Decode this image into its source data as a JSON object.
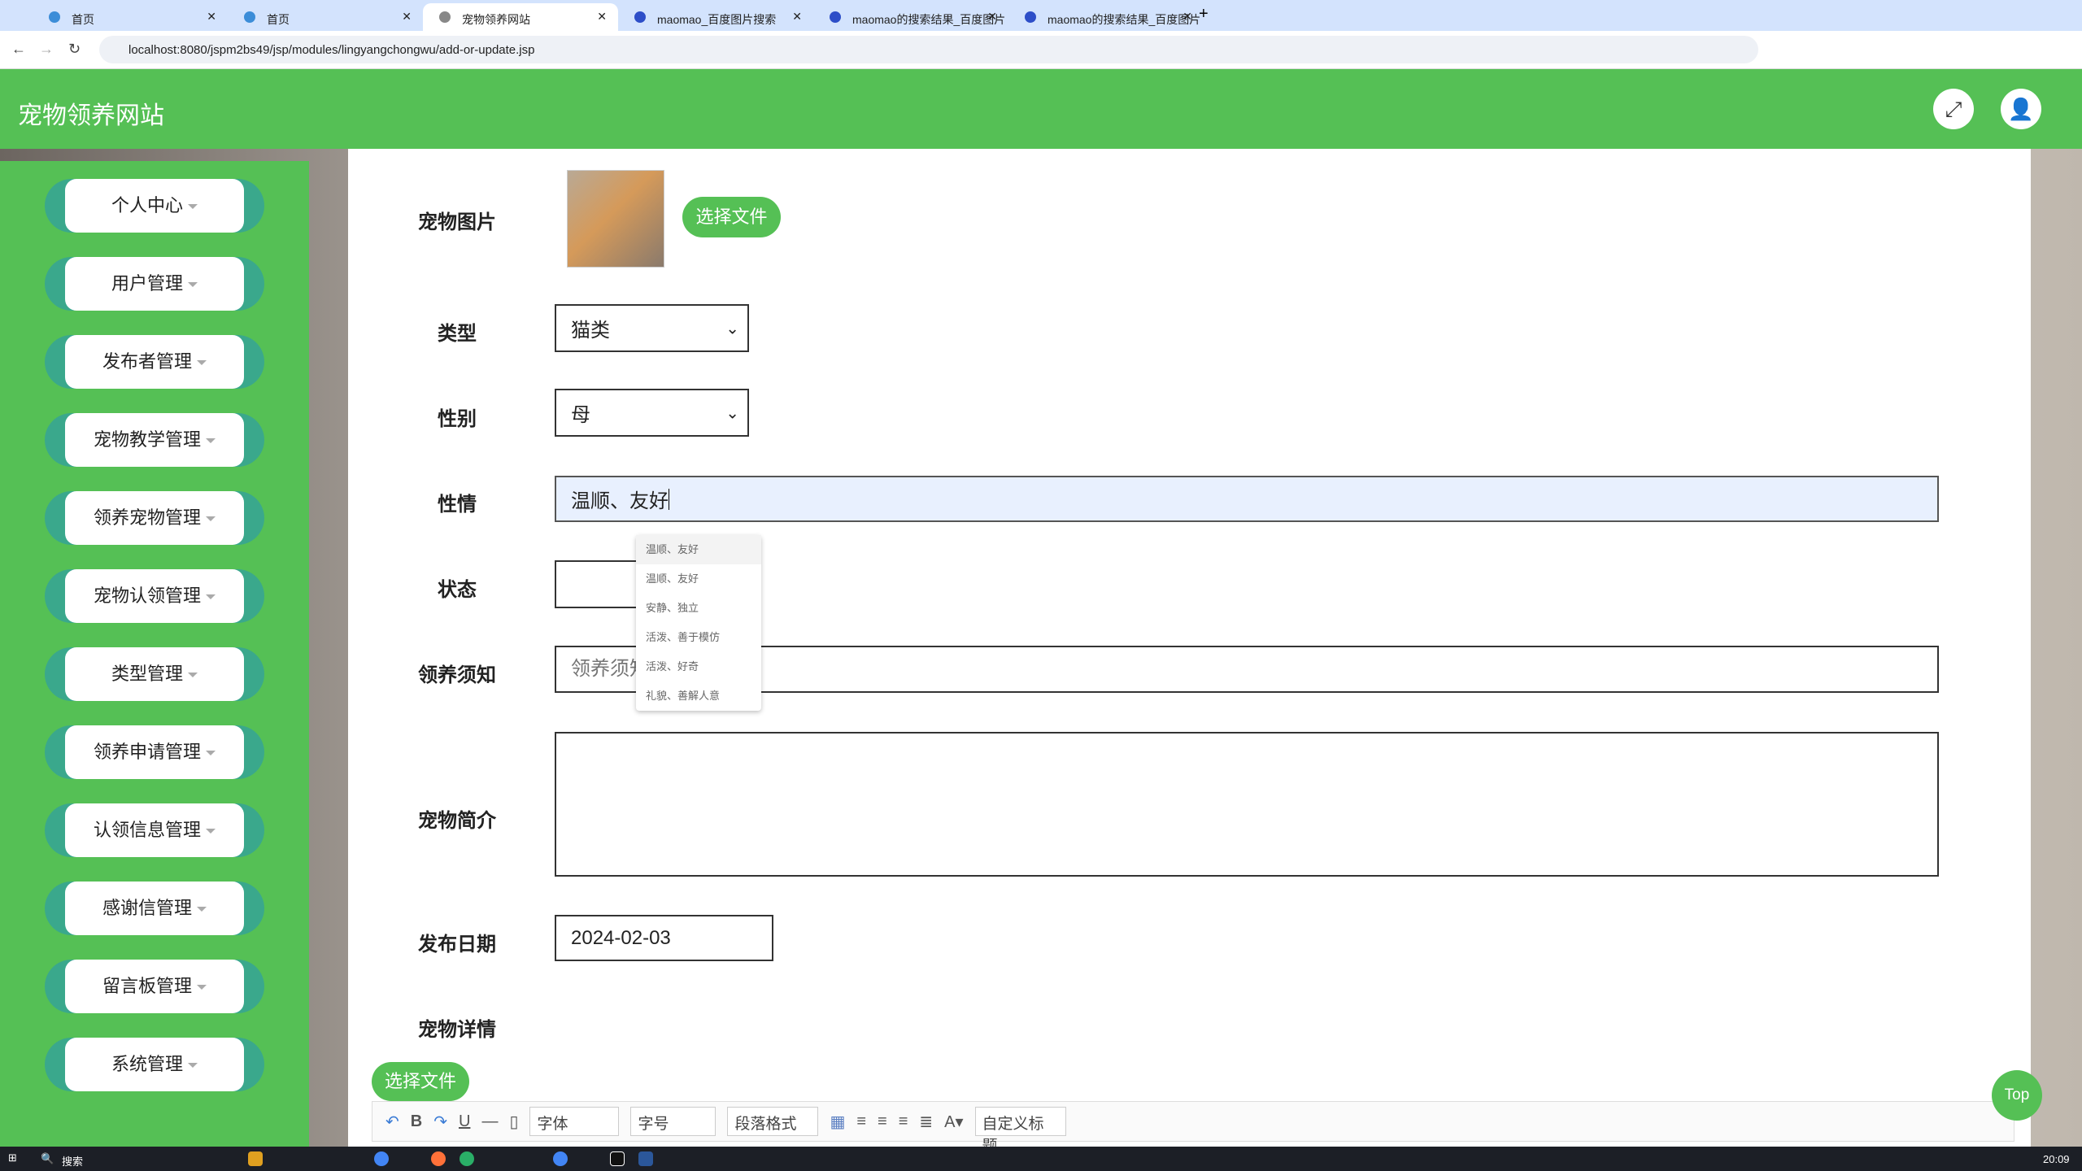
{
  "browser": {
    "tabs": [
      {
        "label": "首页"
      },
      {
        "label": "首页"
      },
      {
        "label": "宠物领养网站",
        "active": true
      },
      {
        "label": "maomao_百度图片搜索"
      },
      {
        "label": "maomao的搜索结果_百度图片"
      },
      {
        "label": "maomao的搜索结果_百度图片"
      }
    ],
    "url": "localhost:8080/jspm2bs49/jsp/modules/lingyangchongwu/add-or-update.jsp"
  },
  "header": {
    "title": "宠物领养网站",
    "fullscreen_icon": "expand-icon",
    "user_icon": "user-icon"
  },
  "sidebar": {
    "items": [
      {
        "label": "个人中心"
      },
      {
        "label": "用户管理"
      },
      {
        "label": "发布者管理"
      },
      {
        "label": "宠物教学管理"
      },
      {
        "label": "领养宠物管理"
      },
      {
        "label": "宠物认领管理"
      },
      {
        "label": "类型管理"
      },
      {
        "label": "领养申请管理"
      },
      {
        "label": "认领信息管理"
      },
      {
        "label": "感谢信管理"
      },
      {
        "label": "留言板管理"
      },
      {
        "label": "系统管理"
      }
    ]
  },
  "form": {
    "image_label": "宠物图片",
    "choose_file": "选择文件",
    "type_label": "类型",
    "type_value": "猫类",
    "gender_label": "性别",
    "gender_value": "母",
    "temper_label": "性情",
    "temper_value": "温顺、友好",
    "status_label": "状态",
    "status_value": "",
    "notice_label": "领养须知",
    "notice_placeholder": "领养须知",
    "intro_label": "宠物简介",
    "date_label": "发布日期",
    "date_value": "2024-02-03",
    "detail_label": "宠物详情",
    "detail_choose_file": "选择文件"
  },
  "autocomplete": {
    "options": [
      "温顺、友好",
      "温顺、友好",
      "安静、独立",
      "活泼、善于模仿",
      "活泼、好奇",
      "礼貌、善解人意"
    ]
  },
  "editor": {
    "font": "字体",
    "size": "字号",
    "paragraph": "段落格式",
    "custom_title": "自定义标题"
  },
  "top_button": "Top",
  "taskbar": {
    "search": "搜索",
    "time": "20:09"
  }
}
